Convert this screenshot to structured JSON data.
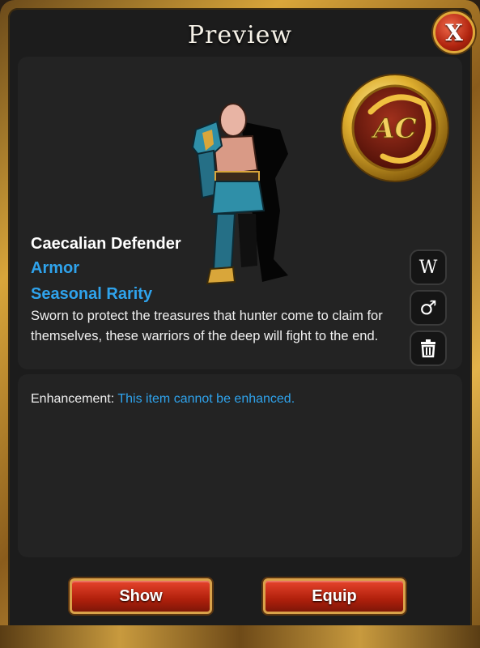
{
  "dialog": {
    "title": "Preview",
    "close_label": "X"
  },
  "logo": {
    "text": "AC"
  },
  "item": {
    "name": "Caecalian Defender",
    "type": "Armor",
    "rarity": "Seasonal Rarity",
    "description": "Sworn to protect the treasures that hunter come to claim for themselves, these warriors of the deep will fight to the end."
  },
  "side_buttons": {
    "wiki_label": "W",
    "gender_label": "♂",
    "delete_icon": "trash-icon"
  },
  "enhancement": {
    "label": "Enhancement:",
    "value": "This item cannot be enhanced."
  },
  "actions": {
    "show_label": "Show",
    "equip_label": "Equip"
  },
  "colors": {
    "accent_blue": "#2fa3ec",
    "button_red": "#b0200c",
    "frame_gold": "#d9a63a"
  }
}
